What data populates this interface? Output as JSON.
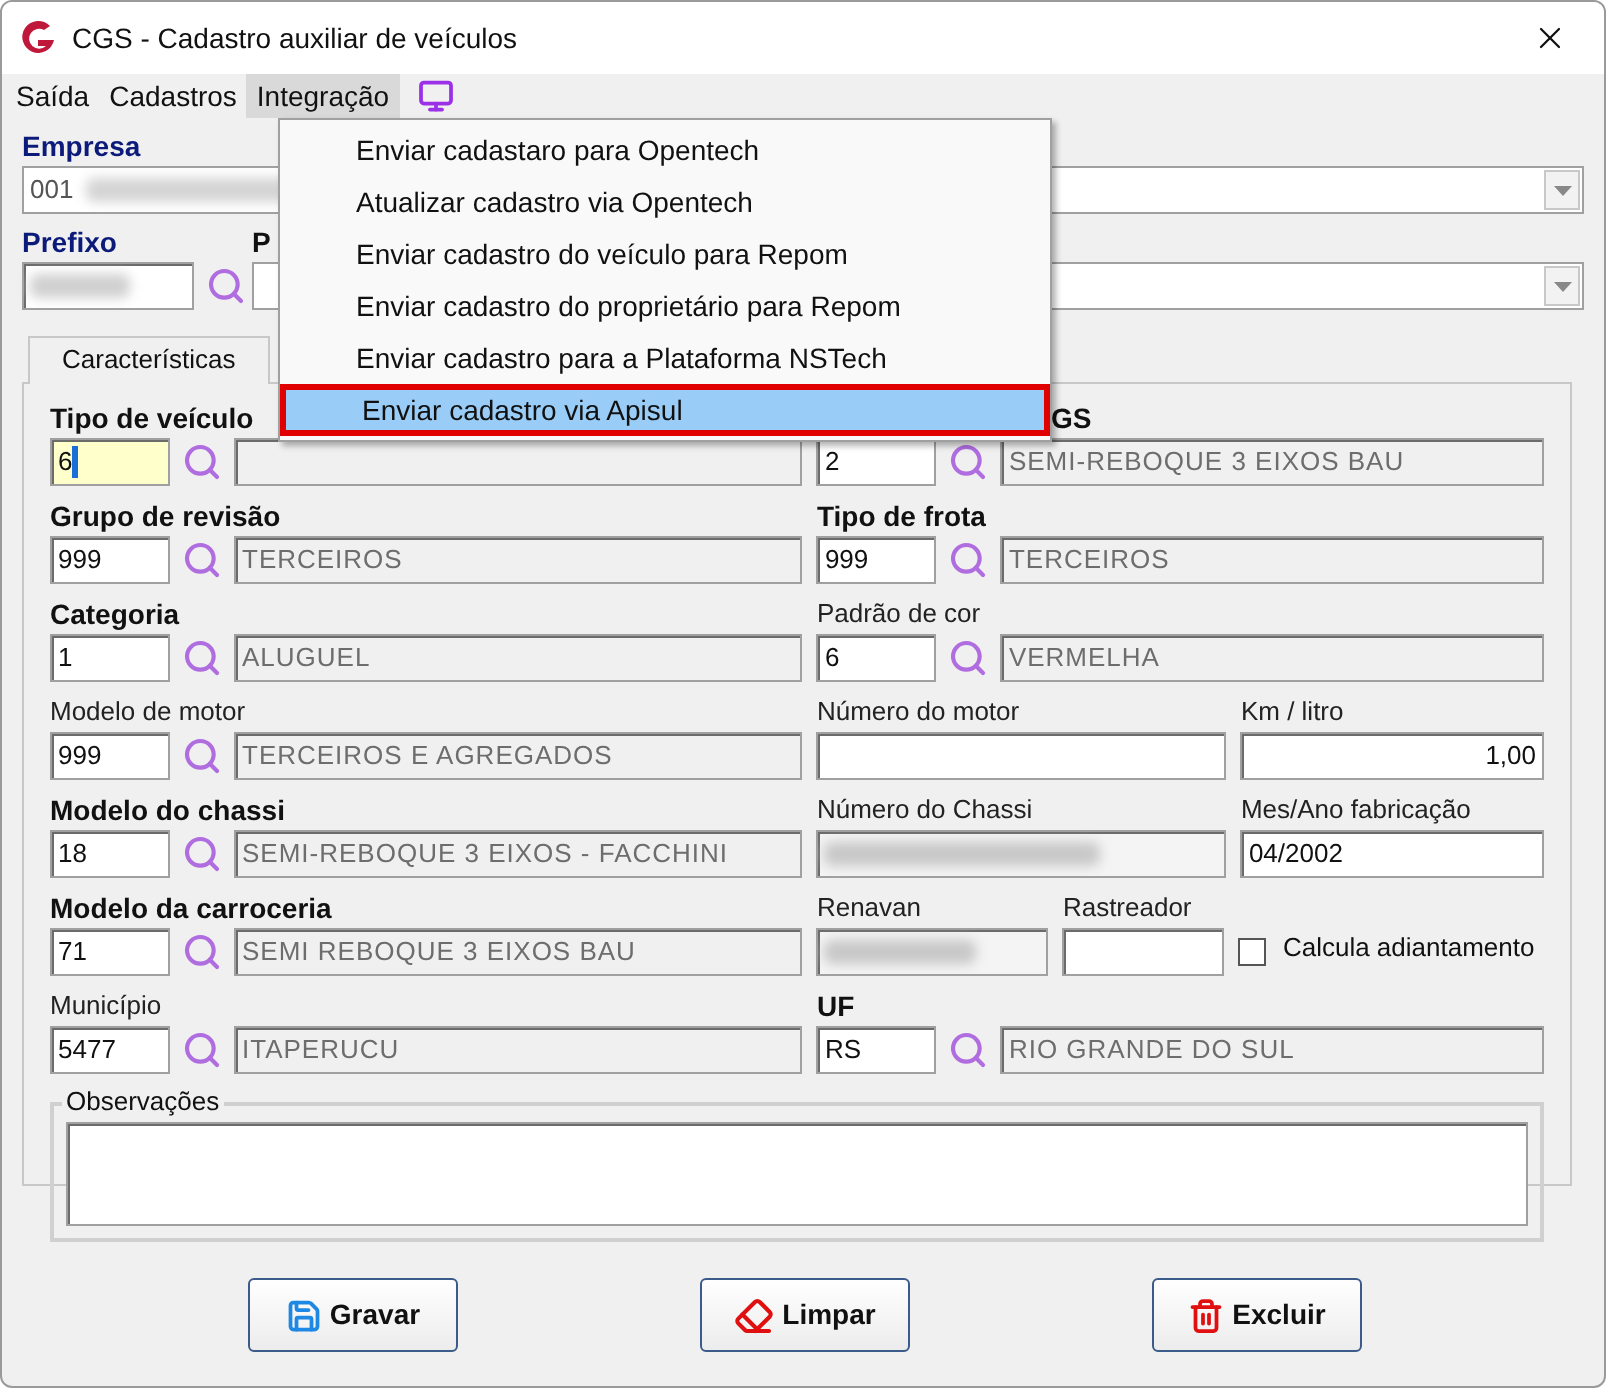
{
  "window": {
    "title": "CGS - Cadastro auxiliar de veículos"
  },
  "menubar": [
    {
      "label": "Saída",
      "selected": false
    },
    {
      "label": "Cadastros",
      "selected": false
    },
    {
      "label": "Integração",
      "selected": true
    }
  ],
  "menu": {
    "items": [
      {
        "label": "Enviar cadastaro para Opentech",
        "selected": false
      },
      {
        "label": "Atualizar cadastro via Opentech",
        "selected": false
      },
      {
        "label": "Enviar cadastro do veículo para Repom",
        "selected": false
      },
      {
        "label": "Enviar cadastro do proprietário para Repom",
        "selected": false
      },
      {
        "label": "Enviar cadastro para a Plataforma NSTech",
        "selected": false
      },
      {
        "label": "Enviar cadastro via Apisul",
        "selected": true
      }
    ]
  },
  "empresa": {
    "label": "Empresa",
    "value": "001"
  },
  "prefixo": {
    "label": "Prefixo",
    "field_2_label": "P"
  },
  "tabs": [
    {
      "label": "Características",
      "selected": true
    }
  ],
  "rows": [
    {
      "left": {
        "label": "Tipo de veículo",
        "bold": true,
        "code": "6",
        "focused": true
      },
      "right": [
        {
          "kind": "lookup",
          "label": "GS",
          "bold": true,
          "code": "2",
          "description": "SEMI-REBOQUE 3 EIXOS BAU"
        }
      ]
    },
    {
      "left": {
        "label": "Grupo de revisão",
        "bold": true,
        "code": "999",
        "focused": false,
        "description": "TERCEIROS"
      },
      "right": [
        {
          "kind": "lookup",
          "label": "Tipo de frota",
          "bold": true,
          "code": "999",
          "description": "TERCEIROS"
        }
      ]
    },
    {
      "left": {
        "label": "Categoria",
        "bold": true,
        "code": "1",
        "focused": false,
        "description": "ALUGUEL"
      },
      "right": [
        {
          "kind": "lookup",
          "label": "Padrão de cor",
          "bold": false,
          "code": "6",
          "description": "VERMELHA"
        }
      ]
    },
    {
      "left": {
        "label": "Modelo de motor",
        "bold": false,
        "code": "999",
        "focused": false,
        "description": "TERCEIROS E AGREGADOS"
      },
      "right": [
        {
          "kind": "text",
          "label": "Número do motor"
        },
        {
          "kind": "number",
          "label": "Km / litro",
          "value": "1,00"
        }
      ]
    },
    {
      "left": {
        "label": "Modelo do chassi",
        "bold": true,
        "code": "18",
        "focused": false,
        "description": "SEMI-REBOQUE 3 EIXOS - FACCHINI"
      },
      "right": [
        {
          "kind": "blurred",
          "label": "Número do Chassi"
        },
        {
          "kind": "text",
          "label": "Mes/Ano fabricação",
          "value": "04/2002"
        }
      ]
    },
    {
      "left": {
        "label": "Modelo da carroceria",
        "bold": true,
        "code": "71",
        "focused": false,
        "description": "SEMI REBOQUE 3 EIXOS BAU"
      },
      "right": [
        {
          "kind": "blurred",
          "label": "Renavan"
        },
        {
          "kind": "text",
          "label": "Rastreador"
        },
        {
          "kind": "checkbox",
          "label": "Calcula adiantamento",
          "checked": false
        }
      ]
    },
    {
      "left": {
        "label": "Município",
        "bold": false,
        "code": "5477",
        "focused": false,
        "description": "ITAPERUCU"
      },
      "right": [
        {
          "kind": "lookup",
          "label": "UF",
          "bold": true,
          "code": "RS",
          "description": "RIO GRANDE DO SUL"
        }
      ]
    }
  ],
  "observacoes": {
    "label": "Observações"
  },
  "buttons": [
    {
      "label": "Gravar",
      "kind": "save"
    },
    {
      "label": "Limpar",
      "kind": "clear"
    },
    {
      "label": "Excluir",
      "kind": "delete"
    }
  ]
}
